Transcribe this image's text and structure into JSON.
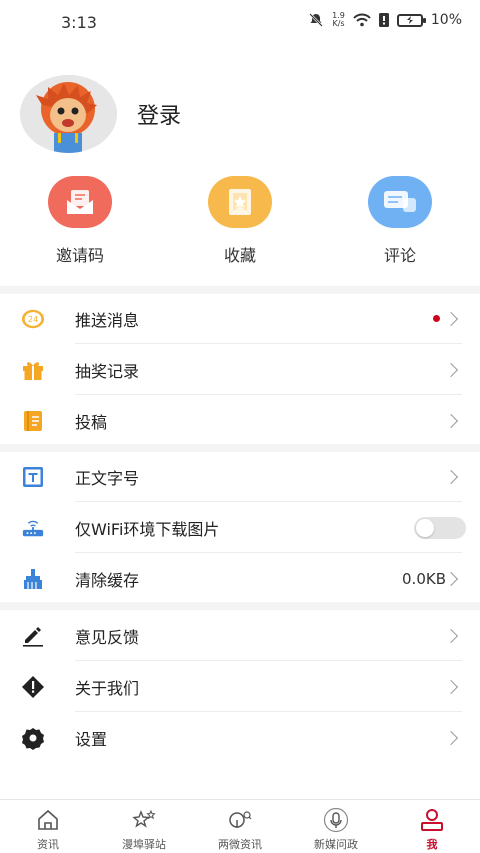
{
  "status_bar": {
    "time": "3:13",
    "speed_top": "1.9",
    "speed_bottom": "K/s",
    "battery": "10%"
  },
  "profile": {
    "login_label": "登录"
  },
  "actions": [
    {
      "label": "邀请码",
      "color": "#f06b5b"
    },
    {
      "label": "收藏",
      "color": "#f7b94b"
    },
    {
      "label": "评论",
      "color": "#6fb1f3"
    }
  ],
  "menu_group1": [
    {
      "label": "推送消息",
      "badge_icon_text": "24"
    },
    {
      "label": "抽奖记录"
    },
    {
      "label": "投稿"
    }
  ],
  "menu_group2": [
    {
      "label": "正文字号"
    },
    {
      "label": "仅WiFi环境下载图片",
      "toggle_on": false
    },
    {
      "label": "清除缓存",
      "value": "0.0KB"
    }
  ],
  "menu_group3": [
    {
      "label": "意见反馈"
    },
    {
      "label": "关于我们"
    },
    {
      "label": "设置"
    }
  ],
  "tabs": [
    {
      "label": "资讯",
      "active": false
    },
    {
      "label": "漫埠驿站",
      "active": false
    },
    {
      "label": "两微资讯",
      "active": false
    },
    {
      "label": "新媒问政",
      "active": false
    },
    {
      "label": "我",
      "active": true
    }
  ],
  "colors": {
    "accent": "#c8102e",
    "notify_dot": "#d0021b"
  }
}
